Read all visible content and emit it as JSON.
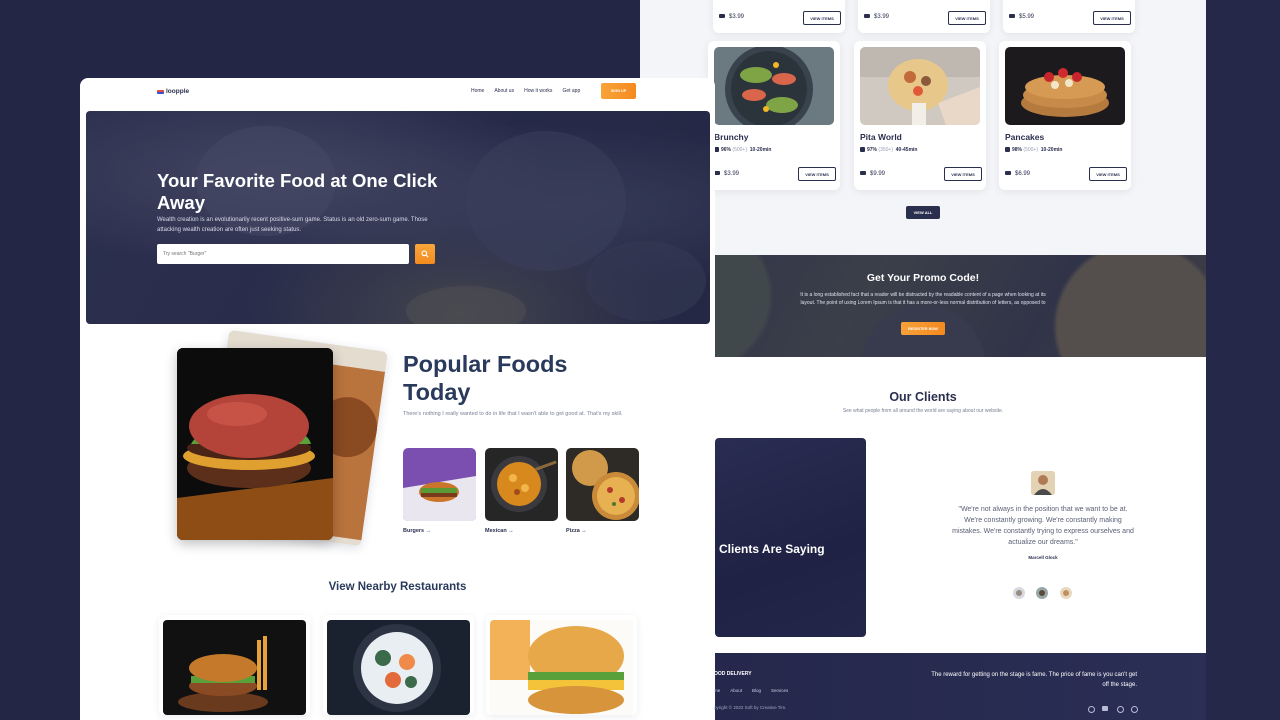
{
  "left": {
    "brand": "loopple",
    "nav": [
      "Home",
      "About us",
      "How it works",
      "Get app"
    ],
    "signup": "SIGN UP",
    "hero": {
      "title": "Your Favorite Food at One Click Away",
      "subtitle": "Wealth creation is an evolutionarily recent positive-sum game. Status is an old zero-sum game. Those attacking wealth creation are often just seeking status.",
      "search_placeholder": "Try search \"Burger\""
    },
    "popular": {
      "title": "Popular Foods Today",
      "subtitle": "There's nothing I really wanted to do in life that I wasn't able to get good at. That's my skill.",
      "categories": [
        {
          "label": "Burgers →"
        },
        {
          "label": "Mexican →"
        },
        {
          "label": "Pizza →"
        }
      ]
    },
    "nearby_title": "View Nearby Restaurants"
  },
  "right": {
    "top_prices": [
      "$3.99",
      "$3.99",
      "$5.99"
    ],
    "view_items": "VIEW ITEMS",
    "restaurants": [
      {
        "name": "Brunchy",
        "rating": "96%",
        "reviews": "(500+)",
        "time": "10-20min",
        "price": "$3.99"
      },
      {
        "name": "Pita World",
        "rating": "97%",
        "reviews": "(350+)",
        "time": "40-45min",
        "price": "$9.99"
      },
      {
        "name": "Pancakes",
        "rating": "98%",
        "reviews": "(500+)",
        "time": "10-20min",
        "price": "$6.99"
      }
    ],
    "view_all": "VIEW ALL",
    "promo": {
      "title": "Get Your Promo Code!",
      "text": "It is a long established fact that a reader will be distracted by the readable content of a page when looking at its layout. The point of using Lorem Ipsum is that it has a more-or-less normal distribution of letters, as opposed to",
      "button": "REGISTER NOW"
    },
    "clients": {
      "title": "Our Clients",
      "subtitle": "See what people from all around the world are saying about our website.",
      "panel_caption": "Clients Are Saying",
      "quote": "\"We're not always in the position that we want to be at. We're constantly growing. We're constantly making mistakes. We're constantly trying to express ourselves and actualize our dreams.\"",
      "author": "Marcell Glock"
    },
    "footer": {
      "brand": "OOD DELIVERY",
      "links": [
        "me",
        "About",
        "Blog",
        "Services"
      ],
      "copyright": "pyright © 2022 Soft by Creative Tim.",
      "tagline": "The reward for getting on the stage is fame. The price of fame is you can't get off the stage."
    }
  },
  "colors": {
    "accent": "#f58a1e",
    "navy": "#2a2f4e",
    "background": "#232645"
  }
}
